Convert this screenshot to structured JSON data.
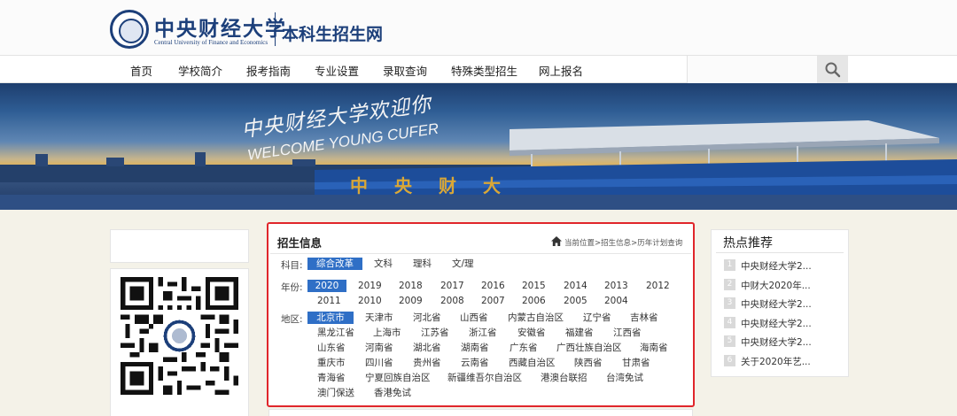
{
  "header": {
    "logo_cn": "中央财经大学",
    "logo_en": "Central University of Finance and Economics",
    "site_name": "本科生招生网"
  },
  "nav": {
    "items": [
      "首页",
      "学校简介",
      "报考指南",
      "专业设置",
      "录取查询",
      "特殊类型招生",
      "网上报名"
    ]
  },
  "banner": {
    "welcome_cn": "中央财经大学欢迎你",
    "welcome_en": "WELCOME YOUNG CUFER",
    "stadium_text": "中央财大"
  },
  "panel": {
    "title": "招生信息",
    "breadcrumb": "当前位置>招生信息>历年计划查询",
    "subject_label": "科目:",
    "subjects": [
      "综合改革",
      "文科",
      "理科",
      "文/理"
    ],
    "subject_selected": "综合改革",
    "year_label": "年份:",
    "years": [
      "2020",
      "2019",
      "2018",
      "2017",
      "2016",
      "2015",
      "2014",
      "2013",
      "2012",
      "2011",
      "2010",
      "2009",
      "2008",
      "2007",
      "2006",
      "2005",
      "2004"
    ],
    "year_selected": "2020",
    "region_label": "地区:",
    "regions": [
      "北京市",
      "天津市",
      "河北省",
      "山西省",
      "内蒙古自治区",
      "辽宁省",
      "吉林省",
      "黑龙江省",
      "上海市",
      "江苏省",
      "浙江省",
      "安徽省",
      "福建省",
      "江西省",
      "山东省",
      "河南省",
      "湖北省",
      "湖南省",
      "广东省",
      "广西壮族自治区",
      "海南省",
      "重庆市",
      "四川省",
      "贵州省",
      "云南省",
      "西藏自治区",
      "陕西省",
      "甘肃省",
      "青海省",
      "宁夏回族自治区",
      "新疆维吾尔自治区",
      "港澳台联招",
      "台湾免试",
      "澳门保送",
      "香港免试"
    ],
    "region_selected": "北京市"
  },
  "hot": {
    "title": "热点推荐",
    "items": [
      {
        "num": "1",
        "text": "中央财经大学2..."
      },
      {
        "num": "2",
        "text": "中财大2020年..."
      },
      {
        "num": "3",
        "text": "中央财经大学2..."
      },
      {
        "num": "4",
        "text": "中央财经大学2..."
      },
      {
        "num": "5",
        "text": "中央财经大学2..."
      },
      {
        "num": "6",
        "text": "关于2020年艺..."
      }
    ]
  },
  "colors": {
    "brand_blue": "#1c3f7a",
    "active_chip": "#2f6fc6",
    "highlight_border": "#e0262b"
  },
  "icons": {
    "search": "search-icon",
    "home": "home-icon",
    "qr": "qr-code"
  }
}
